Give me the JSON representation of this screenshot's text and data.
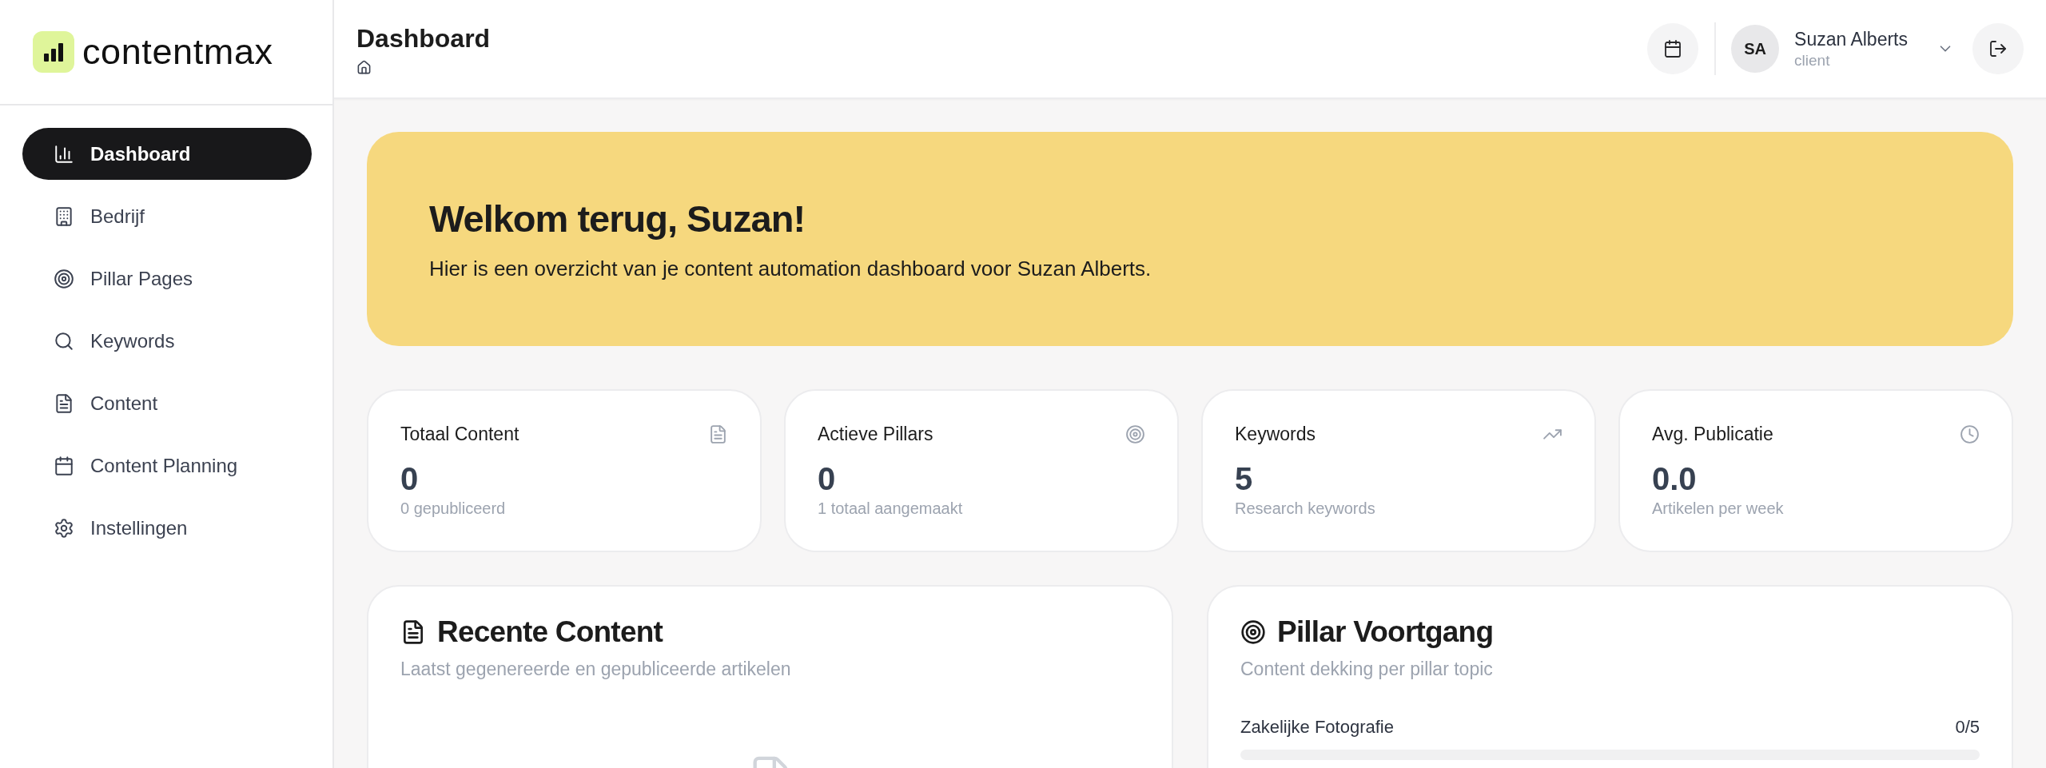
{
  "brand": {
    "name": "contentmax"
  },
  "sidebar": {
    "items": [
      {
        "label": "Dashboard",
        "selected": true
      },
      {
        "label": "Bedrijf",
        "selected": false
      },
      {
        "label": "Pillar Pages",
        "selected": false
      },
      {
        "label": "Keywords",
        "selected": false
      },
      {
        "label": "Content",
        "selected": false
      },
      {
        "label": "Content Planning",
        "selected": false
      },
      {
        "label": "Instellingen",
        "selected": false
      }
    ]
  },
  "header": {
    "title": "Dashboard",
    "user": {
      "initials": "SA",
      "name": "Suzan Alberts",
      "role": "client"
    }
  },
  "banner": {
    "title": "Welkom terug, Suzan!",
    "text": "Hier is een overzicht van je content automation dashboard voor Suzan Alberts."
  },
  "stats": [
    {
      "title": "Totaal Content",
      "value": "0",
      "note": "0 gepubliceerd"
    },
    {
      "title": "Actieve Pillars",
      "value": "0",
      "note": "1 totaal aangemaakt"
    },
    {
      "title": "Keywords",
      "value": "5",
      "note": "Research keywords"
    },
    {
      "title": "Avg. Publicatie",
      "value": "0.0",
      "note": "Artikelen per week"
    }
  ],
  "recent_content": {
    "title": "Recente Content",
    "subtitle": "Laatst gegenereerde en gepubliceerde artikelen"
  },
  "pillar_progress": {
    "title": "Pillar Voortgang",
    "subtitle": "Content dekking per pillar topic",
    "pillars": [
      {
        "name": "Zakelijke Fotografie",
        "count": "0/5",
        "level": 0
      }
    ]
  }
}
